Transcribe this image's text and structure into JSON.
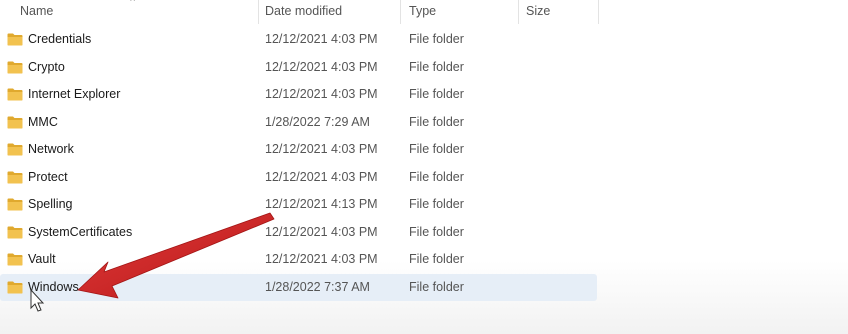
{
  "columns": {
    "name": "Name",
    "date_modified": "Date modified",
    "type": "Type",
    "size": "Size"
  },
  "sort_icon": "sort-ascending-icon",
  "folder_color": "#f2c24f",
  "selected_row_color": "#e6eef7",
  "arrow_color": "#cc1f1f",
  "rows": [
    {
      "name": "Credentials",
      "date": "12/12/2021 4:03 PM",
      "type": "File folder",
      "selected": false
    },
    {
      "name": "Crypto",
      "date": "12/12/2021 4:03 PM",
      "type": "File folder",
      "selected": false
    },
    {
      "name": "Internet Explorer",
      "date": "12/12/2021 4:03 PM",
      "type": "File folder",
      "selected": false
    },
    {
      "name": "MMC",
      "date": "1/28/2022 7:29 AM",
      "type": "File folder",
      "selected": false
    },
    {
      "name": "Network",
      "date": "12/12/2021 4:03 PM",
      "type": "File folder",
      "selected": false
    },
    {
      "name": "Protect",
      "date": "12/12/2021 4:03 PM",
      "type": "File folder",
      "selected": false
    },
    {
      "name": "Spelling",
      "date": "12/12/2021 4:13 PM",
      "type": "File folder",
      "selected": false
    },
    {
      "name": "SystemCertificates",
      "date": "12/12/2021 4:03 PM",
      "type": "File folder",
      "selected": false
    },
    {
      "name": "Vault",
      "date": "12/12/2021 4:03 PM",
      "type": "File folder",
      "selected": false
    },
    {
      "name": "Windows",
      "date": "1/28/2022 7:37 AM",
      "type": "File folder",
      "selected": true
    }
  ]
}
